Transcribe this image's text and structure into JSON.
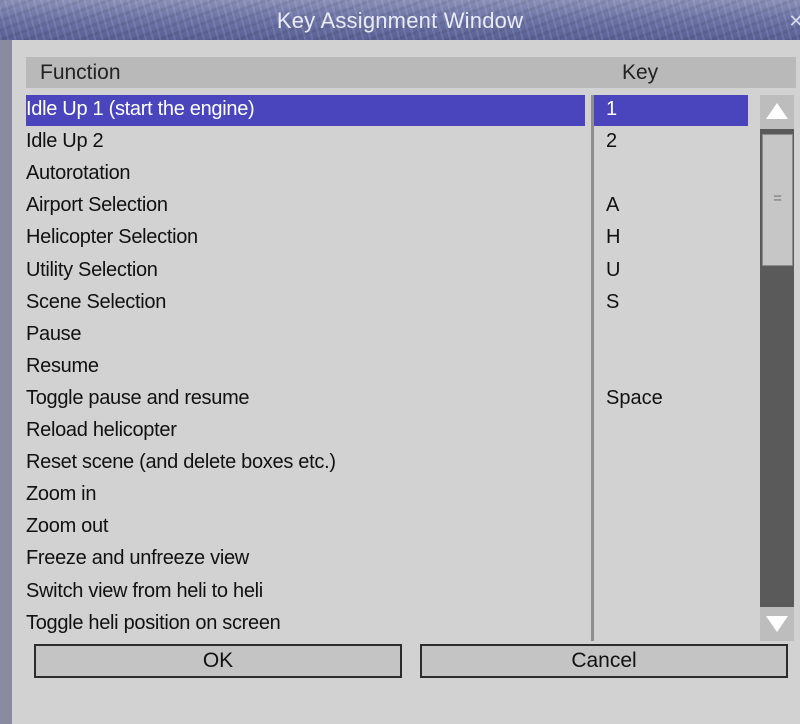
{
  "window": {
    "title": "Key Assignment Window",
    "close_glyph": "✕"
  },
  "table": {
    "headers": {
      "function": "Function",
      "key": "Key"
    },
    "rows": [
      {
        "function": "Idle Up 1 (start the engine)",
        "key": "1",
        "selected": true
      },
      {
        "function": "Idle Up 2",
        "key": "2"
      },
      {
        "function": "Autorotation",
        "key": ""
      },
      {
        "function": "Airport Selection",
        "key": "A"
      },
      {
        "function": "Helicopter Selection",
        "key": "H"
      },
      {
        "function": "Utility Selection",
        "key": "U"
      },
      {
        "function": "Scene Selection",
        "key": "S"
      },
      {
        "function": "Pause",
        "key": ""
      },
      {
        "function": "Resume",
        "key": ""
      },
      {
        "function": "Toggle pause and resume",
        "key": "Space"
      },
      {
        "function": "Reload helicopter",
        "key": ""
      },
      {
        "function": "Reset scene (and delete boxes etc.)",
        "key": ""
      },
      {
        "function": "Zoom in",
        "key": ""
      },
      {
        "function": "Zoom out",
        "key": ""
      },
      {
        "function": "Freeze and unfreeze view",
        "key": ""
      },
      {
        "function": "Switch view from heli to heli",
        "key": ""
      },
      {
        "function": "Toggle heli position on screen",
        "key": ""
      }
    ]
  },
  "scrollbar": {
    "grip_glyph": "="
  },
  "buttons": {
    "ok": "OK",
    "cancel": "Cancel"
  },
  "colors": {
    "selection": "#4a45bd",
    "panel": "#d2d2d2",
    "header": "#b9b9b9"
  }
}
